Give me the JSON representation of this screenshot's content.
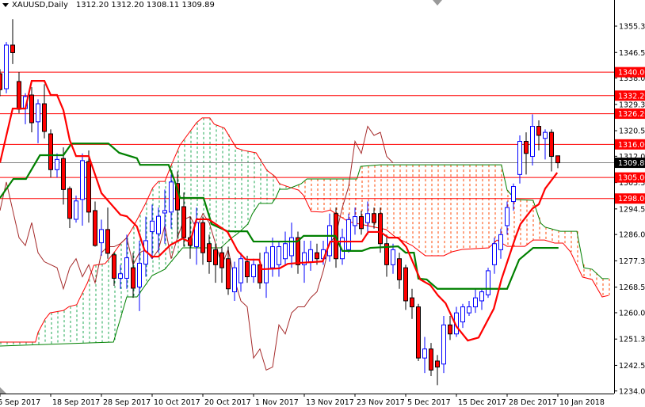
{
  "header": {
    "symbol": "XAUUSD,Daily",
    "ohlc": "1312.20 1312.20 1308.11 1309.89"
  },
  "colors": {
    "bull": "#0000ff",
    "bear": "#ff0000",
    "tenkan": "#ff0000",
    "kijun": "#008000",
    "chikou": "#a52a2a",
    "spanA": "#ff0000",
    "spanB": "#008000",
    "cloud_up": "#22aa55",
    "cloud_down": "#ff4500",
    "level": "#ff0000",
    "current": "#808080"
  },
  "chart_data": {
    "type": "candlestick",
    "title": "XAUUSD,Daily",
    "ylim": [
      1234.05,
      1355.3
    ],
    "y_ticks": [
      "1355.30",
      "1346.55",
      "1338.05",
      "1329.30",
      "1320.55",
      "1312.05",
      "1303.30",
      "1294.55",
      "1286.05",
      "1277.30",
      "1268.55",
      "1260.05",
      "1251.30",
      "1242.55",
      "1234.05"
    ],
    "x_labels": [
      {
        "bar": 0,
        "label": "6 Sep 2017"
      },
      {
        "bar": 8,
        "label": "18 Sep 2017"
      },
      {
        "bar": 16,
        "label": "28 Sep 2017"
      },
      {
        "bar": 24,
        "label": "10 Oct 2017"
      },
      {
        "bar": 32,
        "label": "20 Oct 2017"
      },
      {
        "bar": 40,
        "label": "1 Nov 2017"
      },
      {
        "bar": 48,
        "label": "13 Nov 2017"
      },
      {
        "bar": 56,
        "label": "23 Nov 2017"
      },
      {
        "bar": 64,
        "label": "5 Dec 2017"
      },
      {
        "bar": 72,
        "label": "15 Dec 2017"
      },
      {
        "bar": 80,
        "label": "28 Dec 2017"
      },
      {
        "bar": 88,
        "label": "10 Jan 2018"
      }
    ],
    "levels": [
      "1340.00",
      "1332.20",
      "1326.20",
      "1316.00",
      "1305.00",
      "1298.00"
    ],
    "current_price": "1309.89",
    "candles_ohlc": [
      [
        1339.5,
        1341,
        1332,
        1334.2
      ],
      [
        1334.5,
        1350,
        1333,
        1349
      ],
      [
        1349,
        1357.6,
        1342.7,
        1346.5
      ],
      [
        1336.9,
        1340,
        1326.4,
        1327.7
      ],
      [
        1327.9,
        1333,
        1322.7,
        1331.9
      ],
      [
        1332.4,
        1335,
        1320,
        1323.2
      ],
      [
        1323.5,
        1331,
        1316.4,
        1329.5
      ],
      [
        1329.5,
        1336,
        1318,
        1320.3
      ],
      [
        1319.5,
        1321,
        1305,
        1307.6
      ],
      [
        1307.6,
        1313,
        1305,
        1311
      ],
      [
        1311.3,
        1315,
        1296,
        1301
      ],
      [
        1301.3,
        1302,
        1288.2,
        1291.4
      ],
      [
        1291.1,
        1299,
        1290,
        1297.2
      ],
      [
        1297.7,
        1313,
        1289,
        1310.6
      ],
      [
        1310.3,
        1314,
        1290,
        1293.5
      ],
      [
        1294,
        1297,
        1282,
        1282.4
      ],
      [
        1283.3,
        1291,
        1279,
        1287.7
      ],
      [
        1287.7,
        1295,
        1278,
        1279.8
      ],
      [
        1279.3,
        1280,
        1269,
        1271.5
      ],
      [
        1271.5,
        1276,
        1268,
        1273
      ],
      [
        1271.5,
        1286,
        1268,
        1278.3
      ],
      [
        1275,
        1280,
        1265,
        1268.2
      ],
      [
        1268.6,
        1284,
        1260.6,
        1276.5
      ],
      [
        1276.2,
        1292,
        1272,
        1284
      ],
      [
        1287,
        1296,
        1278,
        1290.5
      ],
      [
        1286.3,
        1295,
        1280,
        1292.1
      ],
      [
        1293.2,
        1301,
        1283,
        1294
      ],
      [
        1293.5,
        1306,
        1288,
        1303.5
      ],
      [
        1303,
        1307,
        1285,
        1294.2
      ],
      [
        1295.3,
        1300,
        1282,
        1285
      ],
      [
        1285,
        1292,
        1278,
        1282.4
      ],
      [
        1282,
        1295,
        1276,
        1290
      ],
      [
        1290,
        1292,
        1276,
        1280
      ],
      [
        1283,
        1286,
        1273,
        1277
      ],
      [
        1281,
        1283,
        1270,
        1276
      ],
      [
        1280,
        1282,
        1270,
        1275
      ],
      [
        1278,
        1282,
        1266,
        1268
      ],
      [
        1267,
        1277,
        1264,
        1275
      ],
      [
        1270,
        1280,
        1267,
        1278
      ],
      [
        1277,
        1279,
        1270,
        1272
      ],
      [
        1272,
        1278,
        1270,
        1276
      ],
      [
        1276,
        1280,
        1268,
        1270
      ],
      [
        1270,
        1282,
        1265,
        1280
      ],
      [
        1275,
        1285,
        1272,
        1282
      ],
      [
        1276,
        1284,
        1272,
        1282
      ],
      [
        1278,
        1287,
        1276,
        1283
      ],
      [
        1279,
        1290,
        1275,
        1285
      ],
      [
        1285,
        1287,
        1273,
        1276
      ],
      [
        1276,
        1284,
        1270,
        1280
      ],
      [
        1277,
        1284,
        1274,
        1281
      ],
      [
        1280,
        1283,
        1276,
        1278
      ],
      [
        1278,
        1284,
        1276,
        1281
      ],
      [
        1279,
        1293,
        1277,
        1289
      ],
      [
        1293,
        1295,
        1275,
        1278
      ],
      [
        1278,
        1288,
        1276,
        1285
      ],
      [
        1281,
        1293,
        1280,
        1291
      ],
      [
        1289,
        1295,
        1286,
        1292
      ],
      [
        1292,
        1294,
        1286,
        1288
      ],
      [
        1290,
        1297,
        1286,
        1293
      ],
      [
        1293,
        1295,
        1288,
        1290
      ],
      [
        1293,
        1295,
        1280,
        1283
      ],
      [
        1283,
        1286,
        1272,
        1276
      ],
      [
        1276,
        1283,
        1273,
        1281
      ],
      [
        1278,
        1280,
        1268,
        1271
      ],
      [
        1275,
        1276,
        1261,
        1264
      ],
      [
        1265,
        1268,
        1258,
        1262
      ],
      [
        1262,
        1263,
        1244,
        1245
      ],
      [
        1245,
        1252,
        1240,
        1248
      ],
      [
        1248,
        1250,
        1239,
        1241
      ],
      [
        1244,
        1246,
        1236,
        1242
      ],
      [
        1243,
        1259,
        1240,
        1256
      ],
      [
        1256,
        1259,
        1251,
        1253
      ],
      [
        1253,
        1262,
        1252,
        1260
      ],
      [
        1257,
        1263,
        1255,
        1262
      ],
      [
        1260,
        1264,
        1259,
        1262
      ],
      [
        1262,
        1268,
        1260,
        1265
      ],
      [
        1264,
        1268,
        1261,
        1267
      ],
      [
        1266,
        1275,
        1265,
        1274
      ],
      [
        1276,
        1285,
        1273,
        1283
      ],
      [
        1281,
        1288,
        1278,
        1286
      ],
      [
        1289,
        1297,
        1286,
        1295
      ],
      [
        1297,
        1303,
        1294,
        1302
      ],
      [
        1306,
        1319,
        1303,
        1317
      ],
      [
        1317,
        1320,
        1306,
        1313
      ],
      [
        1312,
        1326,
        1309,
        1322
      ],
      [
        1322,
        1324,
        1314,
        1319
      ],
      [
        1318,
        1321,
        1311,
        1320
      ],
      [
        1320,
        1321,
        1307,
        1312
      ],
      [
        1312.2,
        1312.2,
        1308.11,
        1309.89
      ]
    ],
    "tenkan": [
      [
        0,
        1309.9
      ],
      [
        2,
        1327.9
      ],
      [
        4,
        1327.9
      ],
      [
        5,
        1337.1
      ],
      [
        7,
        1337.1
      ],
      [
        8,
        1332.4
      ],
      [
        9,
        1332.4
      ],
      [
        10,
        1327.4
      ],
      [
        11,
        1317.4
      ],
      [
        12,
        1312.1
      ],
      [
        14,
        1312.1
      ],
      [
        16,
        1299.8
      ],
      [
        19,
        1292.6
      ],
      [
        20,
        1292.1
      ],
      [
        21.6,
        1288.7
      ],
      [
        22.8,
        1280.8
      ],
      [
        24,
        1278.7
      ],
      [
        25,
        1278.7
      ],
      [
        26.9,
        1282.6
      ],
      [
        28.8,
        1284.7
      ],
      [
        30,
        1283.5
      ],
      [
        31,
        1291.1
      ],
      [
        32.9,
        1291.1
      ],
      [
        35.9,
        1286.9
      ],
      [
        37.5,
        1280.6
      ],
      [
        38.8,
        1277.7
      ],
      [
        40.9,
        1277.7
      ],
      [
        41.3,
        1274.5
      ],
      [
        44.1,
        1274.8
      ],
      [
        45.4,
        1276.3
      ],
      [
        47.1,
        1276.6
      ],
      [
        50.9,
        1277.1
      ],
      [
        52.1,
        1283.7
      ],
      [
        57.1,
        1283.7
      ],
      [
        58.1,
        1286.9
      ],
      [
        60,
        1286.9
      ],
      [
        61.3,
        1285
      ],
      [
        62.8,
        1285
      ],
      [
        64.1,
        1281.9
      ],
      [
        66.3,
        1271.1
      ],
      [
        67.9,
        1269.2
      ],
      [
        69.1,
        1265.8
      ],
      [
        70.3,
        1263.2
      ],
      [
        72,
        1255.5
      ],
      [
        73.8,
        1250.8
      ],
      [
        75.5,
        1251.8
      ],
      [
        77.9,
        1261.4
      ],
      [
        79.1,
        1271.1
      ],
      [
        81.3,
        1285
      ],
      [
        82.1,
        1289.5
      ],
      [
        84,
        1294.7
      ],
      [
        85,
        1296.1
      ],
      [
        86,
        1301.3
      ],
      [
        87.9,
        1306.6
      ]
    ],
    "kijun": [
      [
        0,
        1298.2
      ],
      [
        2.1,
        1304.5
      ],
      [
        4.1,
        1304.5
      ],
      [
        6.3,
        1312.4
      ],
      [
        10,
        1312.4
      ],
      [
        11.3,
        1316.3
      ],
      [
        17.1,
        1316.3
      ],
      [
        18.8,
        1313.2
      ],
      [
        21.6,
        1311.4
      ],
      [
        22.1,
        1309.2
      ],
      [
        26.6,
        1309.2
      ],
      [
        27.5,
        1304.2
      ],
      [
        28.4,
        1298.2
      ],
      [
        32.1,
        1298.2
      ],
      [
        33.4,
        1289.5
      ],
      [
        35.9,
        1287.1
      ],
      [
        39,
        1287.1
      ],
      [
        40,
        1283.7
      ],
      [
        46.9,
        1283.7
      ],
      [
        47.9,
        1285.6
      ],
      [
        52.9,
        1285.6
      ],
      [
        54,
        1280.6
      ],
      [
        57.1,
        1280.6
      ],
      [
        58.4,
        1281.6
      ],
      [
        62.8,
        1282.1
      ],
      [
        64,
        1280
      ],
      [
        65.3,
        1280
      ],
      [
        66,
        1271.4
      ],
      [
        67.3,
        1271.1
      ],
      [
        69,
        1268
      ],
      [
        80,
        1268
      ],
      [
        81.9,
        1277.7
      ],
      [
        84.1,
        1281.6
      ],
      [
        88.1,
        1281.6
      ]
    ],
    "span_a": [
      [
        0,
        1250.3
      ],
      [
        5.6,
        1250.3
      ],
      [
        6,
        1253.5
      ],
      [
        7.1,
        1257.9
      ],
      [
        7.9,
        1260
      ],
      [
        10,
        1260.8
      ],
      [
        10.9,
        1262.1
      ],
      [
        12.1,
        1262.7
      ],
      [
        12.5,
        1264.5
      ],
      [
        13.8,
        1270
      ],
      [
        14.8,
        1275.8
      ],
      [
        16.6,
        1276.4
      ],
      [
        17.9,
        1279.8
      ],
      [
        19.1,
        1283.2
      ],
      [
        20,
        1285
      ],
      [
        21,
        1288.5
      ],
      [
        22.9,
        1296.1
      ],
      [
        24.1,
        1301.6
      ],
      [
        25,
        1303.7
      ],
      [
        26,
        1303.7
      ],
      [
        27.1,
        1309.5
      ],
      [
        28.4,
        1315.8
      ],
      [
        31,
        1323.2
      ],
      [
        31.9,
        1324.8
      ],
      [
        33.1,
        1324.8
      ],
      [
        33.8,
        1322.7
      ],
      [
        35.4,
        1321.4
      ],
      [
        37.3,
        1314.8
      ],
      [
        38.4,
        1314
      ],
      [
        40.4,
        1313.2
      ],
      [
        42.1,
        1307.4
      ],
      [
        43.4,
        1305.3
      ],
      [
        44.1,
        1302.9
      ],
      [
        45.9,
        1301.6
      ],
      [
        47.1,
        1300.8
      ],
      [
        47.9,
        1299
      ],
      [
        49.1,
        1293.7
      ],
      [
        50.9,
        1293.5
      ],
      [
        52.1,
        1294.2
      ],
      [
        53.4,
        1292.4
      ],
      [
        55,
        1290.3
      ],
      [
        60.9,
        1287.7
      ],
      [
        62.5,
        1285
      ],
      [
        65,
        1282.4
      ],
      [
        67.1,
        1279
      ],
      [
        70,
        1279
      ],
      [
        71.3,
        1280.3
      ],
      [
        72.9,
        1281.1
      ],
      [
        77.1,
        1281.6
      ],
      [
        78.4,
        1284.2
      ],
      [
        80,
        1282.1
      ],
      [
        82.8,
        1282.1
      ],
      [
        84.1,
        1284.2
      ],
      [
        85.9,
        1284.2
      ],
      [
        87.5,
        1283.2
      ],
      [
        88.8,
        1283.2
      ],
      [
        90,
        1280.3
      ],
      [
        91.9,
        1271.9
      ],
      [
        93.4,
        1271.1
      ],
      [
        95,
        1265.3
      ],
      [
        96,
        1265.8
      ]
    ],
    "span_b": [
      [
        0,
        1249
      ],
      [
        17.9,
        1250.3
      ],
      [
        20,
        1265.3
      ],
      [
        21.6,
        1265.3
      ],
      [
        24,
        1272.4
      ],
      [
        26,
        1274.5
      ],
      [
        28.8,
        1281.6
      ],
      [
        34.8,
        1281.6
      ],
      [
        36.6,
        1285
      ],
      [
        37.5,
        1286.4
      ],
      [
        39.1,
        1289.5
      ],
      [
        39.8,
        1292.9
      ],
      [
        40.9,
        1296.4
      ],
      [
        42.9,
        1296.4
      ],
      [
        43.5,
        1298.2
      ],
      [
        44.1,
        1301.1
      ],
      [
        45.3,
        1301.1
      ],
      [
        47.5,
        1302.9
      ],
      [
        48.4,
        1304.5
      ],
      [
        56.3,
        1304.5
      ],
      [
        56.9,
        1308.7
      ],
      [
        60,
        1309.2
      ],
      [
        79.1,
        1309.2
      ],
      [
        80,
        1300.8
      ],
      [
        81.3,
        1297.7
      ],
      [
        84.1,
        1297.4
      ],
      [
        85.3,
        1289.8
      ],
      [
        86,
        1288.5
      ],
      [
        88.4,
        1287.1
      ],
      [
        91,
        1287.1
      ],
      [
        92.1,
        1275
      ],
      [
        93.4,
        1274.5
      ],
      [
        95,
        1271.4
      ],
      [
        96,
        1271.4
      ]
    ],
    "chikou_shift": 26
  }
}
